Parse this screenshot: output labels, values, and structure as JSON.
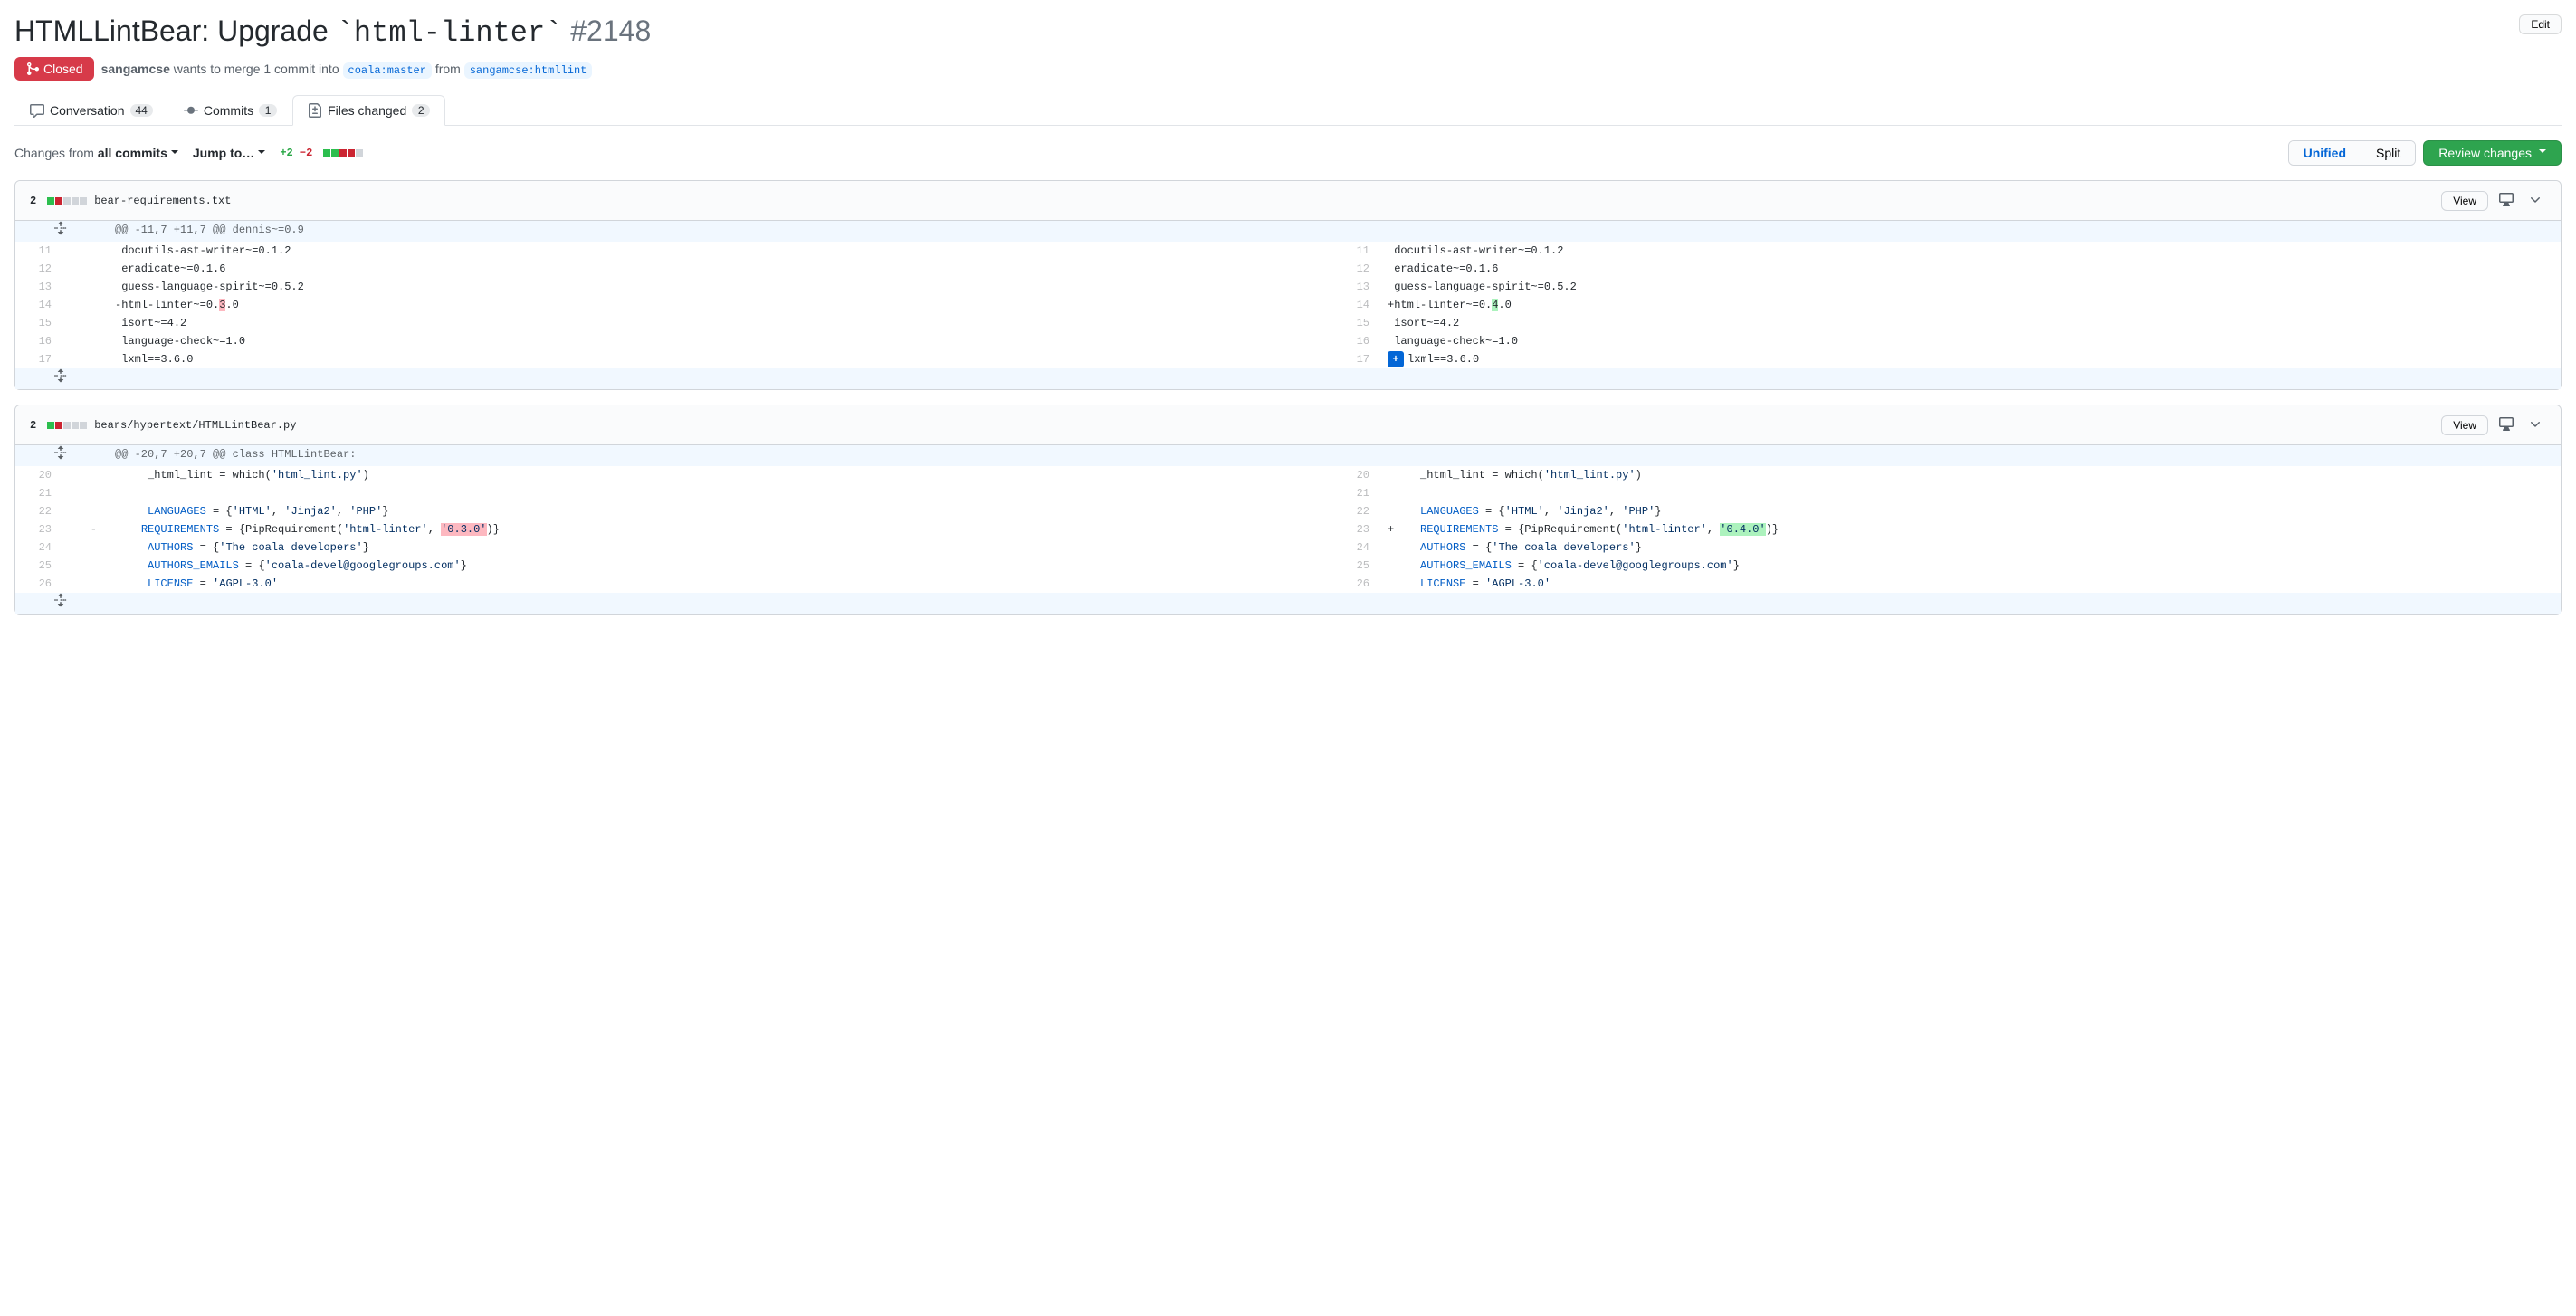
{
  "title_prefix": "HTMLLintBear: Upgrade ",
  "title_code": "`html-linter`",
  "pr_number": "#2148",
  "edit_label": "Edit",
  "state": "Closed",
  "author": "sangamcse",
  "merge_text_1": " wants to merge 1 commit into ",
  "base_branch": "coala:master",
  "merge_text_2": " from ",
  "head_branch": "sangamcse:htmllint",
  "tabs": {
    "conversation": {
      "label": "Conversation",
      "count": "44"
    },
    "commits": {
      "label": "Commits",
      "count": "1"
    },
    "files": {
      "label": "Files changed",
      "count": "2"
    }
  },
  "toolbar": {
    "changes_from": "Changes from ",
    "all_commits": "all commits",
    "jump_to": "Jump to…",
    "additions": "+2",
    "deletions": "−2",
    "unified": "Unified",
    "split": "Split",
    "review": "Review changes"
  },
  "file1": {
    "changes": "2",
    "path": "bear-requirements.txt",
    "view": "View",
    "hunk": "@@ -11,7 +11,7 @@ dennis~=0.9",
    "l11": "docutils-ast-writer~=0.1.2",
    "l12": "eradicate~=0.1.6",
    "l13": "guess-language-spirit~=0.5.2",
    "del_pre": "-html-linter~=0.",
    "del_x": "3",
    "del_post": ".0",
    "add_pre": "+html-linter~=0.",
    "add_x": "4",
    "add_post": ".0",
    "l15": "isort~=4.2",
    "l16": "language-check~=1.0",
    "l17": "lxml==3.6.0"
  },
  "file2": {
    "changes": "2",
    "path": "bears/hypertext/HTMLLintBear.py",
    "view": "View",
    "hunk": "@@ -20,7 +20,7 @@ class HTMLLintBear:",
    "l20_a": "_html_lint = which(",
    "l20_b": "'html_lint.py'",
    "l20_c": ")",
    "l22_a": "LANGUAGES",
    "l22_b": " = {",
    "l22_c": "'HTML'",
    "l22_d": ", ",
    "l22_e": "'Jinja2'",
    "l22_f": ", ",
    "l22_g": "'PHP'",
    "l22_h": "}",
    "l23_a": "REQUIREMENTS",
    "l23_b": " = {PipRequirement(",
    "l23_c": "'html-linter'",
    "l23_d": ", ",
    "l23_old": "'0.3.0'",
    "l23_new": "'0.4.0'",
    "l23_e": ")}",
    "l24_a": "AUTHORS",
    "l24_b": " = {",
    "l24_c": "'The coala developers'",
    "l24_d": "}",
    "l25_a": "AUTHORS_EMAILS",
    "l25_b": " = {",
    "l25_c": "'coala-devel@googlegroups.com'",
    "l25_d": "}",
    "l26_a": "LICENSE",
    "l26_b": " = ",
    "l26_c": "'AGPL-3.0'"
  }
}
